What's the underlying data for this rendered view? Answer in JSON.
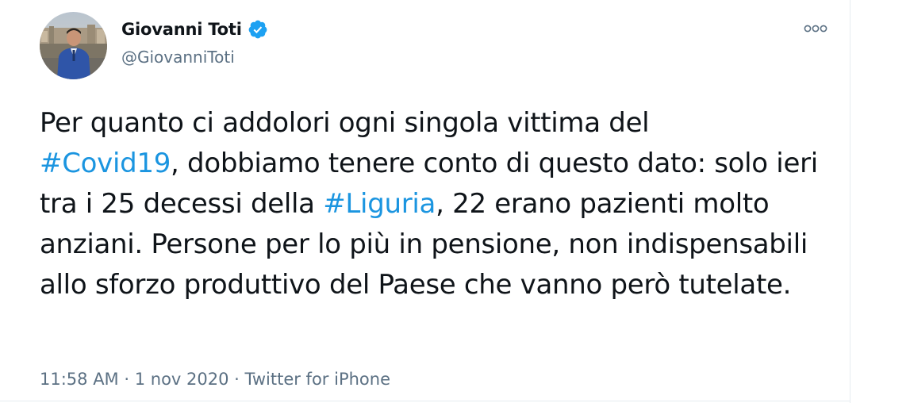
{
  "author": {
    "display_name": "Giovanni Toti",
    "handle": "@GiovanniToti",
    "verified": true
  },
  "tweet": {
    "segments": [
      {
        "text": "Per quanto ci addolori ogni singola vittima del",
        "type": "text"
      },
      {
        "text": "#Covid19",
        "type": "hashtag"
      },
      {
        "text": ", dobbiamo tenere conto di questo dato: solo ieri tra i 25 decessi della ",
        "type": "text"
      },
      {
        "text": "#Liguria",
        "type": "hashtag"
      },
      {
        "text": ", 22 erano pazienti molto anziani. Persone per lo più in pensione, non indispensabili allo sforzo produttivo del Paese che vanno però tutelate.",
        "type": "text"
      }
    ]
  },
  "meta": {
    "time": "11:58 AM",
    "separator1": " · ",
    "date": "1 nov 2020",
    "separator2": " · ",
    "source": "Twitter for iPhone"
  },
  "icons": {
    "verified": "verified-badge-icon",
    "more": "more-options-icon"
  },
  "colors": {
    "hashtag": "#1b95e0",
    "secondary_text": "#5b7083",
    "verified_badge": "#1da1f2",
    "primary_text": "#0f1419"
  }
}
